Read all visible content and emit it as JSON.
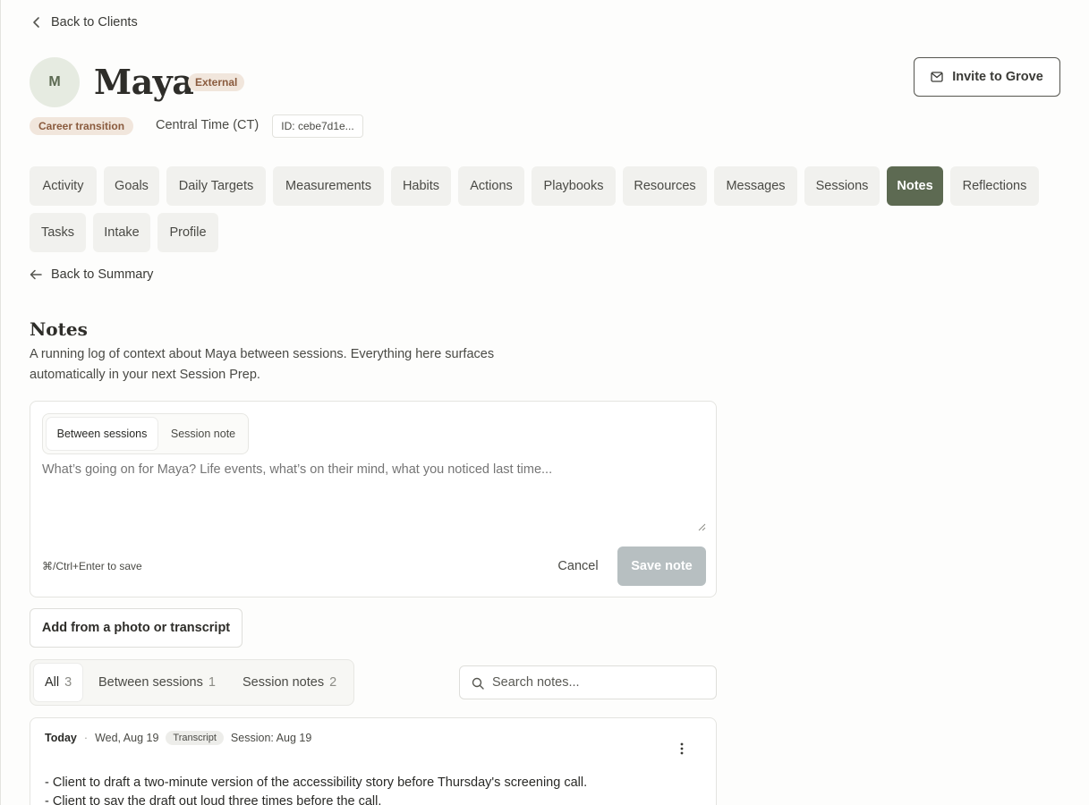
{
  "nav": {
    "back_to_clients": "Back to Clients",
    "back_to_summary": "Back to Summary"
  },
  "client": {
    "initial": "M",
    "name": "Maya",
    "external_badge": "External",
    "tag": "Career transition",
    "timezone": "Central Time (CT)",
    "id": "ID: cebe7d1e..."
  },
  "invite": {
    "label": "Invite to Grove",
    "icon": "mail-icon"
  },
  "tabs": [
    {
      "label": "Activity"
    },
    {
      "label": "Goals"
    },
    {
      "label": "Daily Targets"
    },
    {
      "label": "Measurements"
    },
    {
      "label": "Habits"
    },
    {
      "label": "Actions"
    },
    {
      "label": "Playbooks"
    },
    {
      "label": "Resources"
    },
    {
      "label": "Messages"
    },
    {
      "label": "Sessions"
    },
    {
      "label": "Notes",
      "active": true
    },
    {
      "label": "Reflections"
    },
    {
      "label": "Tasks"
    },
    {
      "label": "Intake"
    },
    {
      "label": "Profile"
    }
  ],
  "notes": {
    "title": "Notes",
    "description": "A running log of context about Maya between sessions. Everything here surfaces automatically in your next Session Prep."
  },
  "composer": {
    "modes": [
      "Between sessions",
      "Session note"
    ],
    "active_mode": "Between sessions",
    "placeholder": "What’s going on for Maya? Life events, what’s on their mind, what you noticed last time...",
    "value": "",
    "shortcut_hint": "⌘/Ctrl+Enter to save",
    "cancel_label": "Cancel",
    "save_label": "Save note"
  },
  "add_photo_label": "Add from a photo or transcript",
  "filters": [
    {
      "label": "All",
      "count": "3",
      "active": true
    },
    {
      "label": "Between sessions",
      "count": "1"
    },
    {
      "label": "Session notes",
      "count": "2"
    }
  ],
  "search": {
    "placeholder": "Search notes...",
    "value": ""
  },
  "note": {
    "day": "Today",
    "separator": "·",
    "date": "Wed, Aug 19",
    "badge": "Transcript",
    "session": "Session: Aug 19",
    "lines": [
      "- Client to draft a two-minute version of the accessibility story before Thursday's screening call.",
      "- Client to say the draft out loud three times before the call."
    ]
  },
  "colors": {
    "accent": "#5d6a52",
    "tag_bg": "#f1e6dc",
    "tag_text": "#8a5b3e",
    "save_disabled": "#b7bfc1"
  }
}
